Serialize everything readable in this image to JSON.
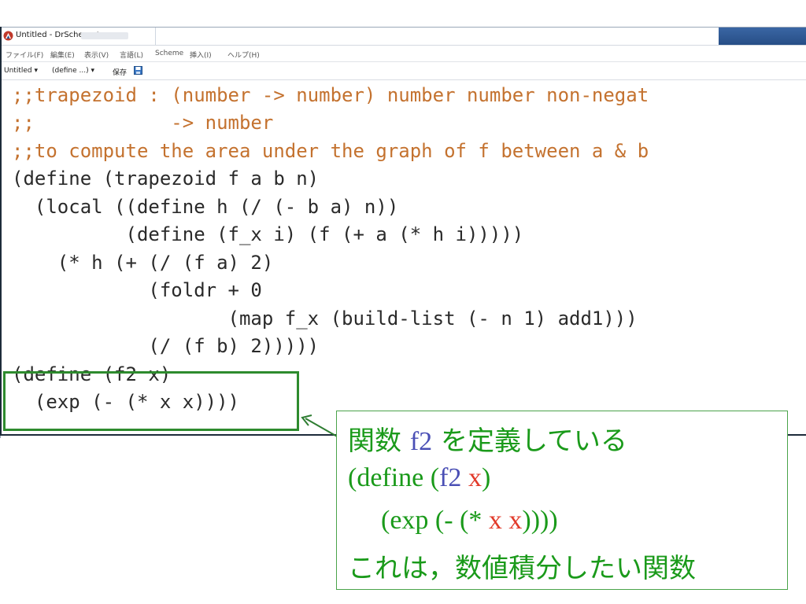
{
  "window": {
    "title": "Untitled - DrScheme*"
  },
  "menubar": {
    "items": [
      "ファイル(F)",
      "編集(E)",
      "表示(V)",
      "言語(L)",
      "Scheme",
      "挿入(I)",
      "ヘルプ(H)"
    ]
  },
  "toolbar": {
    "file_menu": "Untitled ▾",
    "define_menu": "(define ...) ▾",
    "save_label": "保存"
  },
  "editor": {
    "lines": [
      ";;trapezoid : (number -> number) number number non-negat",
      ";;            -> number",
      ";;to compute the area under the graph of f between a & b",
      "(define (trapezoid f a b n)",
      "  (local ((define h (/ (- b a) n))",
      "          (define (f_x i) (f (+ a (* h i)))))",
      "    (* h (+ (/ (f a) 2)",
      "            (foldr + 0",
      "                   (map f_x (build-list (- n 1) add1)))",
      "            (/ (f b) 2)))))",
      "(define (f2 x)",
      "  (exp (- (* x x))))"
    ]
  },
  "callout": {
    "line1_prefix": "関数 ",
    "line1_fn": "f2",
    "line1_suffix": " を定義している",
    "line2_a": "(define (",
    "line2_fn": "f2",
    "line2_b": " ",
    "line2_var": "x",
    "line2_c": ")",
    "line3_a": "(exp (- (* ",
    "line3_var1": "x",
    "line3_b": " ",
    "line3_var2": "x",
    "line3_c": "))))",
    "line4": "これは，数値積分したい関数"
  },
  "colors": {
    "comment": "#c4722f",
    "code": "#2a2a2a",
    "highlight_box": "#2e8b2e",
    "callout_text": "#1a9a1a",
    "callout_fn": "#4a4fb5",
    "callout_var": "#e23a2a"
  }
}
